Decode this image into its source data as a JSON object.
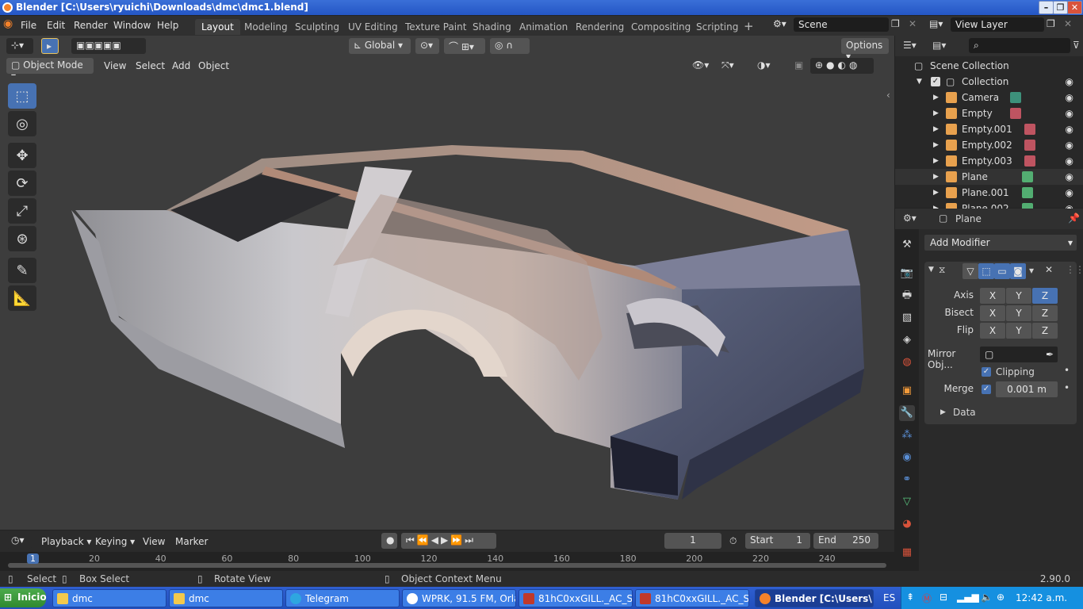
{
  "window": {
    "title": "Blender [C:\\Users\\ryuichi\\Downloads\\dmc\\dmc1.blend]"
  },
  "menubar": {
    "items": [
      "File",
      "Edit",
      "Render",
      "Window",
      "Help"
    ]
  },
  "workspaces": [
    "Layout",
    "Modeling",
    "Sculpting",
    "UV Editing",
    "Texture Paint",
    "Shading",
    "Animation",
    "Rendering",
    "Compositing",
    "Scripting"
  ],
  "scene": {
    "name": "Scene",
    "view_layer": "View Layer"
  },
  "viewport_header": {
    "transform": "Global",
    "options": "Options",
    "mode": "Object Mode",
    "menus": [
      "View",
      "Select",
      "Add",
      "Object"
    ]
  },
  "outliner": {
    "root": "Scene Collection",
    "collection": "Collection",
    "items": [
      {
        "name": "Camera",
        "icon_color": "#e8a14e",
        "sub_color": "#41a38a"
      },
      {
        "name": "Empty",
        "icon_color": "#e8a14e",
        "sub_color": "#d95c6b"
      },
      {
        "name": "Empty.001",
        "icon_color": "#e8a14e",
        "sub_color": "#d95c6b"
      },
      {
        "name": "Empty.002",
        "icon_color": "#e8a14e",
        "sub_color": "#d95c6b"
      },
      {
        "name": "Empty.003",
        "icon_color": "#e8a14e",
        "sub_color": "#d95c6b"
      },
      {
        "name": "Plane",
        "icon_color": "#e8a14e",
        "sub_color": "#59c47e"
      },
      {
        "name": "Plane.001",
        "icon_color": "#e8a14e",
        "sub_color": "#59c47e"
      },
      {
        "name": "Plane.002",
        "icon_color": "#e8a14e",
        "sub_color": "#59c47e"
      }
    ]
  },
  "properties": {
    "object": "Plane",
    "add_modifier": "Add Modifier",
    "axis_label": "Axis",
    "bisect_label": "Bisect",
    "flip_label": "Flip",
    "xyz": [
      "X",
      "Y",
      "Z"
    ],
    "mirror_obj_label": "Mirror Obj...",
    "clipping_label": "Clipping",
    "merge_label": "Merge",
    "merge_value": "0.001 m",
    "data_label": "Data"
  },
  "timeline": {
    "menus": [
      "Playback",
      "Keying",
      "View",
      "Marker"
    ],
    "current_frame": "1",
    "start_label": "Start",
    "start": "1",
    "end_label": "End",
    "end": "250",
    "ticks": [
      "1",
      "20",
      "40",
      "60",
      "80",
      "100",
      "120",
      "140",
      "160",
      "180",
      "200",
      "220",
      "240"
    ]
  },
  "statusbar": {
    "select": "Select",
    "box_select": "Box Select",
    "rotate_view": "Rotate View",
    "context_menu": "Object Context Menu",
    "version": "2.90.0"
  },
  "taskbar": {
    "start": "Inicio",
    "tasks": [
      "dmc",
      "dmc",
      "Telegram",
      "WPRK, 91.5 FM, Orla...",
      "81hC0xxGILL._AC_SL...",
      "81hC0xxGILL._AC_SL...",
      "Blender [C:\\Users\\..."
    ],
    "lang": "ES",
    "clock": "12:42 a.m."
  }
}
